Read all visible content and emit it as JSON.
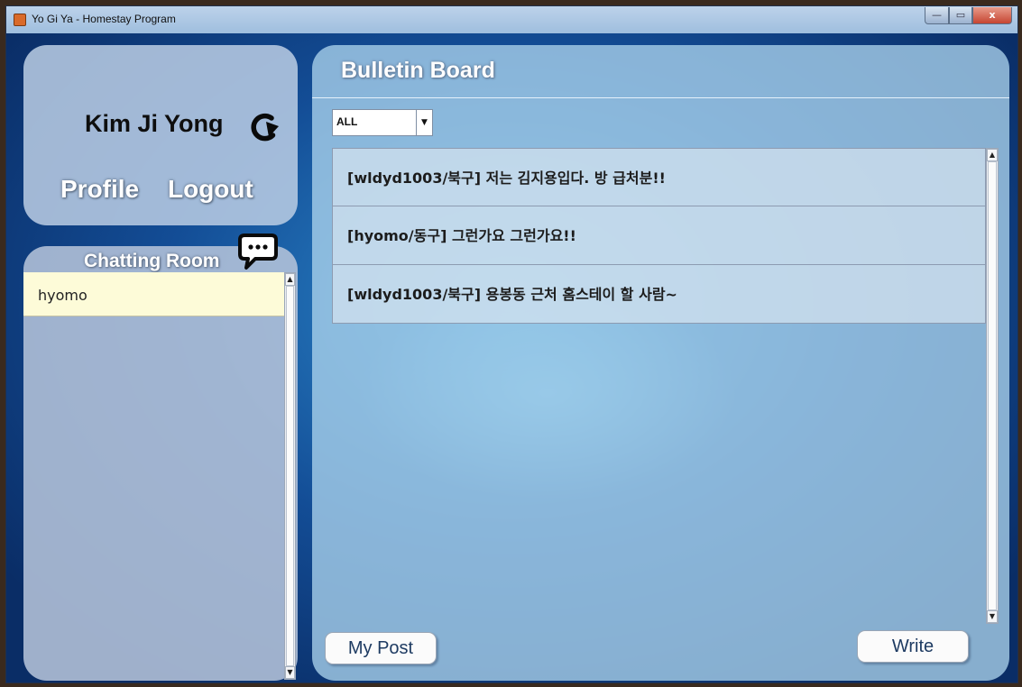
{
  "window": {
    "title": "Yo Gi Ya - Homestay Program",
    "controls": {
      "minimize": "—",
      "maximize": "▭",
      "close": "x"
    }
  },
  "profile": {
    "user_name": "Kim Ji Yong",
    "profile_label": "Profile",
    "logout_label": "Logout"
  },
  "chat": {
    "title": "Chatting Room",
    "rooms": [
      "hyomo"
    ]
  },
  "board": {
    "title": "Bulletin Board",
    "filter": {
      "selected": "ALL",
      "arrow": "▼"
    },
    "posts": [
      "[wldyd1003/북구] 저는 김지용입다. 방 급처분!!",
      "[hyomo/동구] 그런가요 그런가요!!",
      "[wldyd1003/북구]  용봉동 근처 홈스테이 할 사람~"
    ],
    "my_post_label": "My Post",
    "write_label": "Write"
  },
  "scroll": {
    "up": "▲",
    "down": "▼"
  },
  "icons": {
    "app": "java-app-icon",
    "refresh": "refresh-icon",
    "chat": "chat-bubble-icon"
  },
  "colors": {
    "background": "#134d96",
    "chat_item": "#fdfbd8",
    "button_text": "#1e3b62"
  }
}
